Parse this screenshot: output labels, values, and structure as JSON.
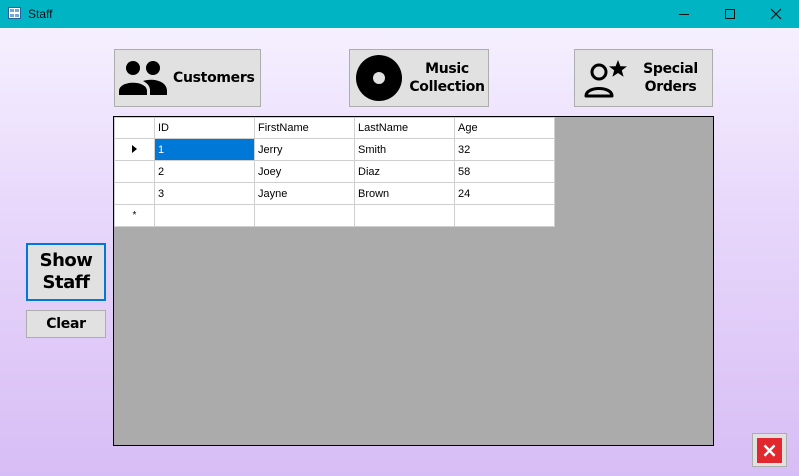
{
  "window": {
    "title": "Staff",
    "controls": [
      "minimize-icon",
      "maximize-icon",
      "close-icon"
    ]
  },
  "nav": {
    "customers_label": "Customers",
    "music_line1": "Music",
    "music_line2": "Collection",
    "special_line1": "Special",
    "special_line2": "Orders"
  },
  "grid": {
    "columns": [
      "ID",
      "FirstName",
      "LastName",
      "Age"
    ],
    "rows": [
      {
        "id": "1",
        "first": "Jerry",
        "last": "Smith",
        "age": "32"
      },
      {
        "id": "2",
        "first": "Joey",
        "last": "Diaz",
        "age": "58"
      },
      {
        "id": "3",
        "first": "Jayne",
        "last": "Brown",
        "age": "24"
      }
    ],
    "new_row_marker": "*",
    "selected_row": 0,
    "selected_column": "ID"
  },
  "actions": {
    "show_line1": "Show",
    "show_line2": "Staff",
    "clear_label": "Clear"
  },
  "exit": {
    "icon": "close-icon",
    "label": "×"
  },
  "colors": {
    "titlebar": "#00b4c4",
    "selection": "#0078d7",
    "exit": "#e0282e",
    "grid_background": "#ababab"
  }
}
